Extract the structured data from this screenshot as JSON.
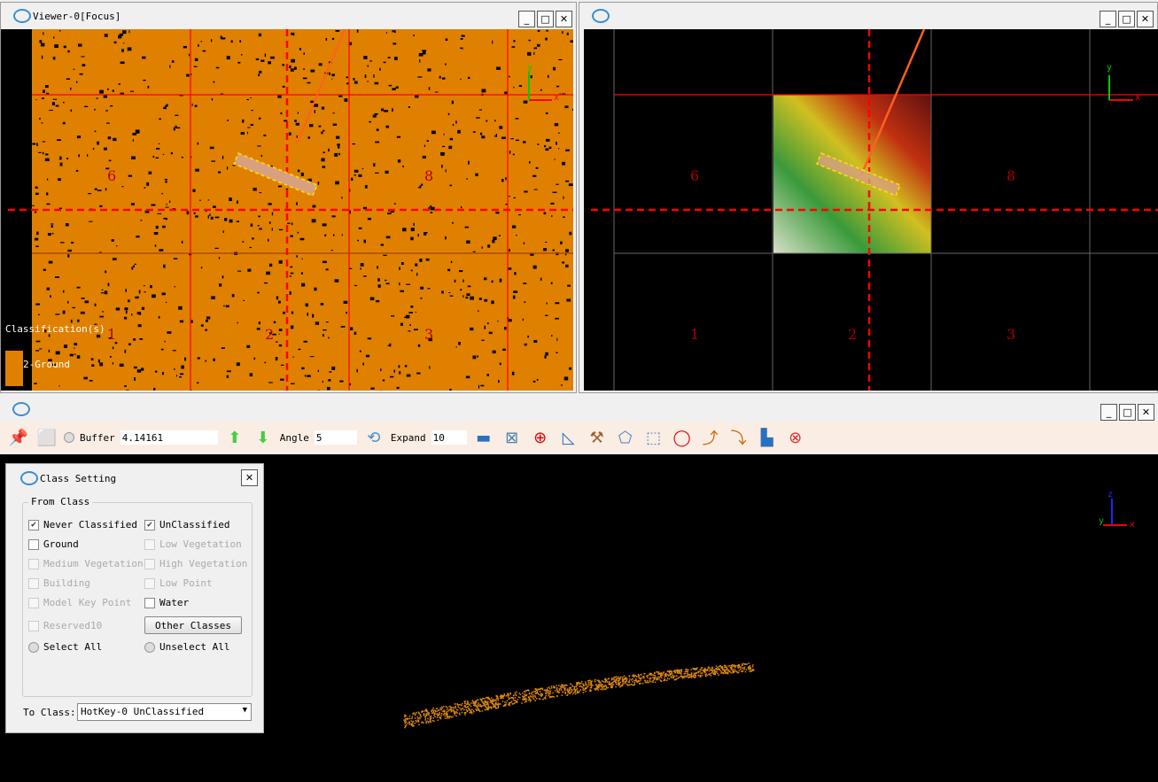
{
  "viewer_left": {
    "title": "Viewer-0[Focus]",
    "legend_title": "Classification(s)",
    "legend_item": "2-Ground",
    "legend_color": "#e08000",
    "cells": [
      "6",
      "8",
      "1",
      "2",
      "3"
    ]
  },
  "viewer_right": {
    "title": "",
    "cells": [
      "6",
      "8",
      "1",
      "2",
      "3"
    ]
  },
  "window_buttons": {
    "minimize": "_",
    "maximize": "□",
    "close": "✕"
  },
  "toolbar": {
    "buffer_label": "Buffer",
    "buffer_value": "4.14161",
    "angle_label": "Angle",
    "angle_value": "5",
    "expand_label": "Expand",
    "expand_value": "10"
  },
  "axes": {
    "x": "x",
    "y": "y",
    "z": "z"
  },
  "class_setting": {
    "title": "Class Setting",
    "group": "From Class",
    "classes": [
      {
        "label": "Never Classified",
        "checked": true,
        "enabled": true
      },
      {
        "label": "UnClassified",
        "checked": true,
        "enabled": true
      },
      {
        "label": "Ground",
        "checked": false,
        "enabled": true
      },
      {
        "label": "Low Vegetation",
        "checked": false,
        "enabled": false
      },
      {
        "label": "Medium Vegetation",
        "checked": false,
        "enabled": false
      },
      {
        "label": "High Vegetation",
        "checked": false,
        "enabled": false
      },
      {
        "label": "Building",
        "checked": false,
        "enabled": false
      },
      {
        "label": "Low Point",
        "checked": false,
        "enabled": false
      },
      {
        "label": "Model Key Point",
        "checked": false,
        "enabled": false
      },
      {
        "label": "Water",
        "checked": false,
        "enabled": true
      },
      {
        "label": "Reserved10",
        "checked": false,
        "enabled": false
      }
    ],
    "other_classes": "Other Classes",
    "select_all": "Select All",
    "unselect_all": "Unselect All",
    "to_label": "To  Class:",
    "to_value": "HotKey-0  UnClassified"
  },
  "colors": {
    "ground": "#e08000",
    "grid_red": "#ff0000",
    "profile": "#e08a10"
  }
}
